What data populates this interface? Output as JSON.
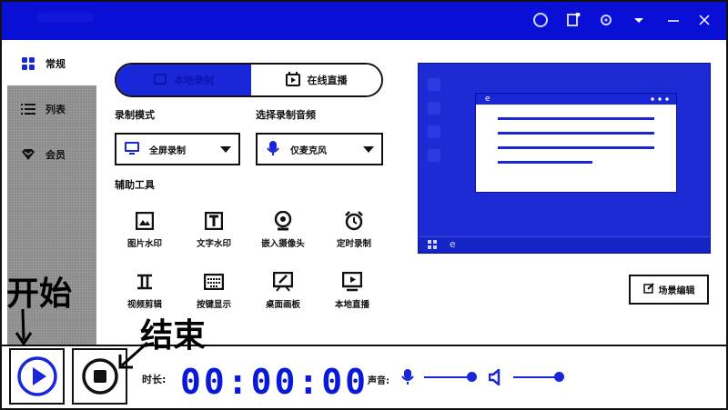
{
  "window": {
    "controls": {
      "avatar_icon": "user-circle-icon",
      "notify_icon": "notification-icon",
      "settings_icon": "gear-icon",
      "dropdown_icon": "chevron-down-icon",
      "minimize_icon": "minimize-icon",
      "close_icon": "close-icon"
    }
  },
  "sidebar": {
    "items": [
      {
        "label": "常规",
        "icon": "grid-icon"
      },
      {
        "label": "列表",
        "icon": "list-icon"
      },
      {
        "label": "会员",
        "icon": "gem-icon"
      }
    ]
  },
  "mode_tabs": {
    "local": "本地录制",
    "live": "在线直播"
  },
  "record_mode": {
    "label": "录制模式",
    "value": "全屏录制"
  },
  "audio_select": {
    "label": "选择录制音频",
    "value": "仅麦克风"
  },
  "tools": {
    "label": "辅助工具",
    "items": [
      {
        "label": "图片水印",
        "icon": "image-icon"
      },
      {
        "label": "文字水印",
        "icon": "text-icon"
      },
      {
        "label": "嵌入摄像头",
        "icon": "webcam-icon"
      },
      {
        "label": "定时录制",
        "icon": "alarm-clock-icon"
      },
      {
        "label": "视频剪辑",
        "icon": "cut-icon"
      },
      {
        "label": "按键显示",
        "icon": "keyboard-icon"
      },
      {
        "label": "桌面画板",
        "icon": "whiteboard-icon"
      },
      {
        "label": "本地直播",
        "icon": "live-play-icon"
      }
    ]
  },
  "scene_button": "场景编辑",
  "controls": {
    "time_label": "时长:",
    "time": "00:00:00",
    "sound_label": "声音:"
  },
  "annotations": {
    "start": "开始",
    "end": "结束"
  },
  "colors": {
    "accent": "#0a0fd6",
    "preview": "#1c2bd3"
  }
}
